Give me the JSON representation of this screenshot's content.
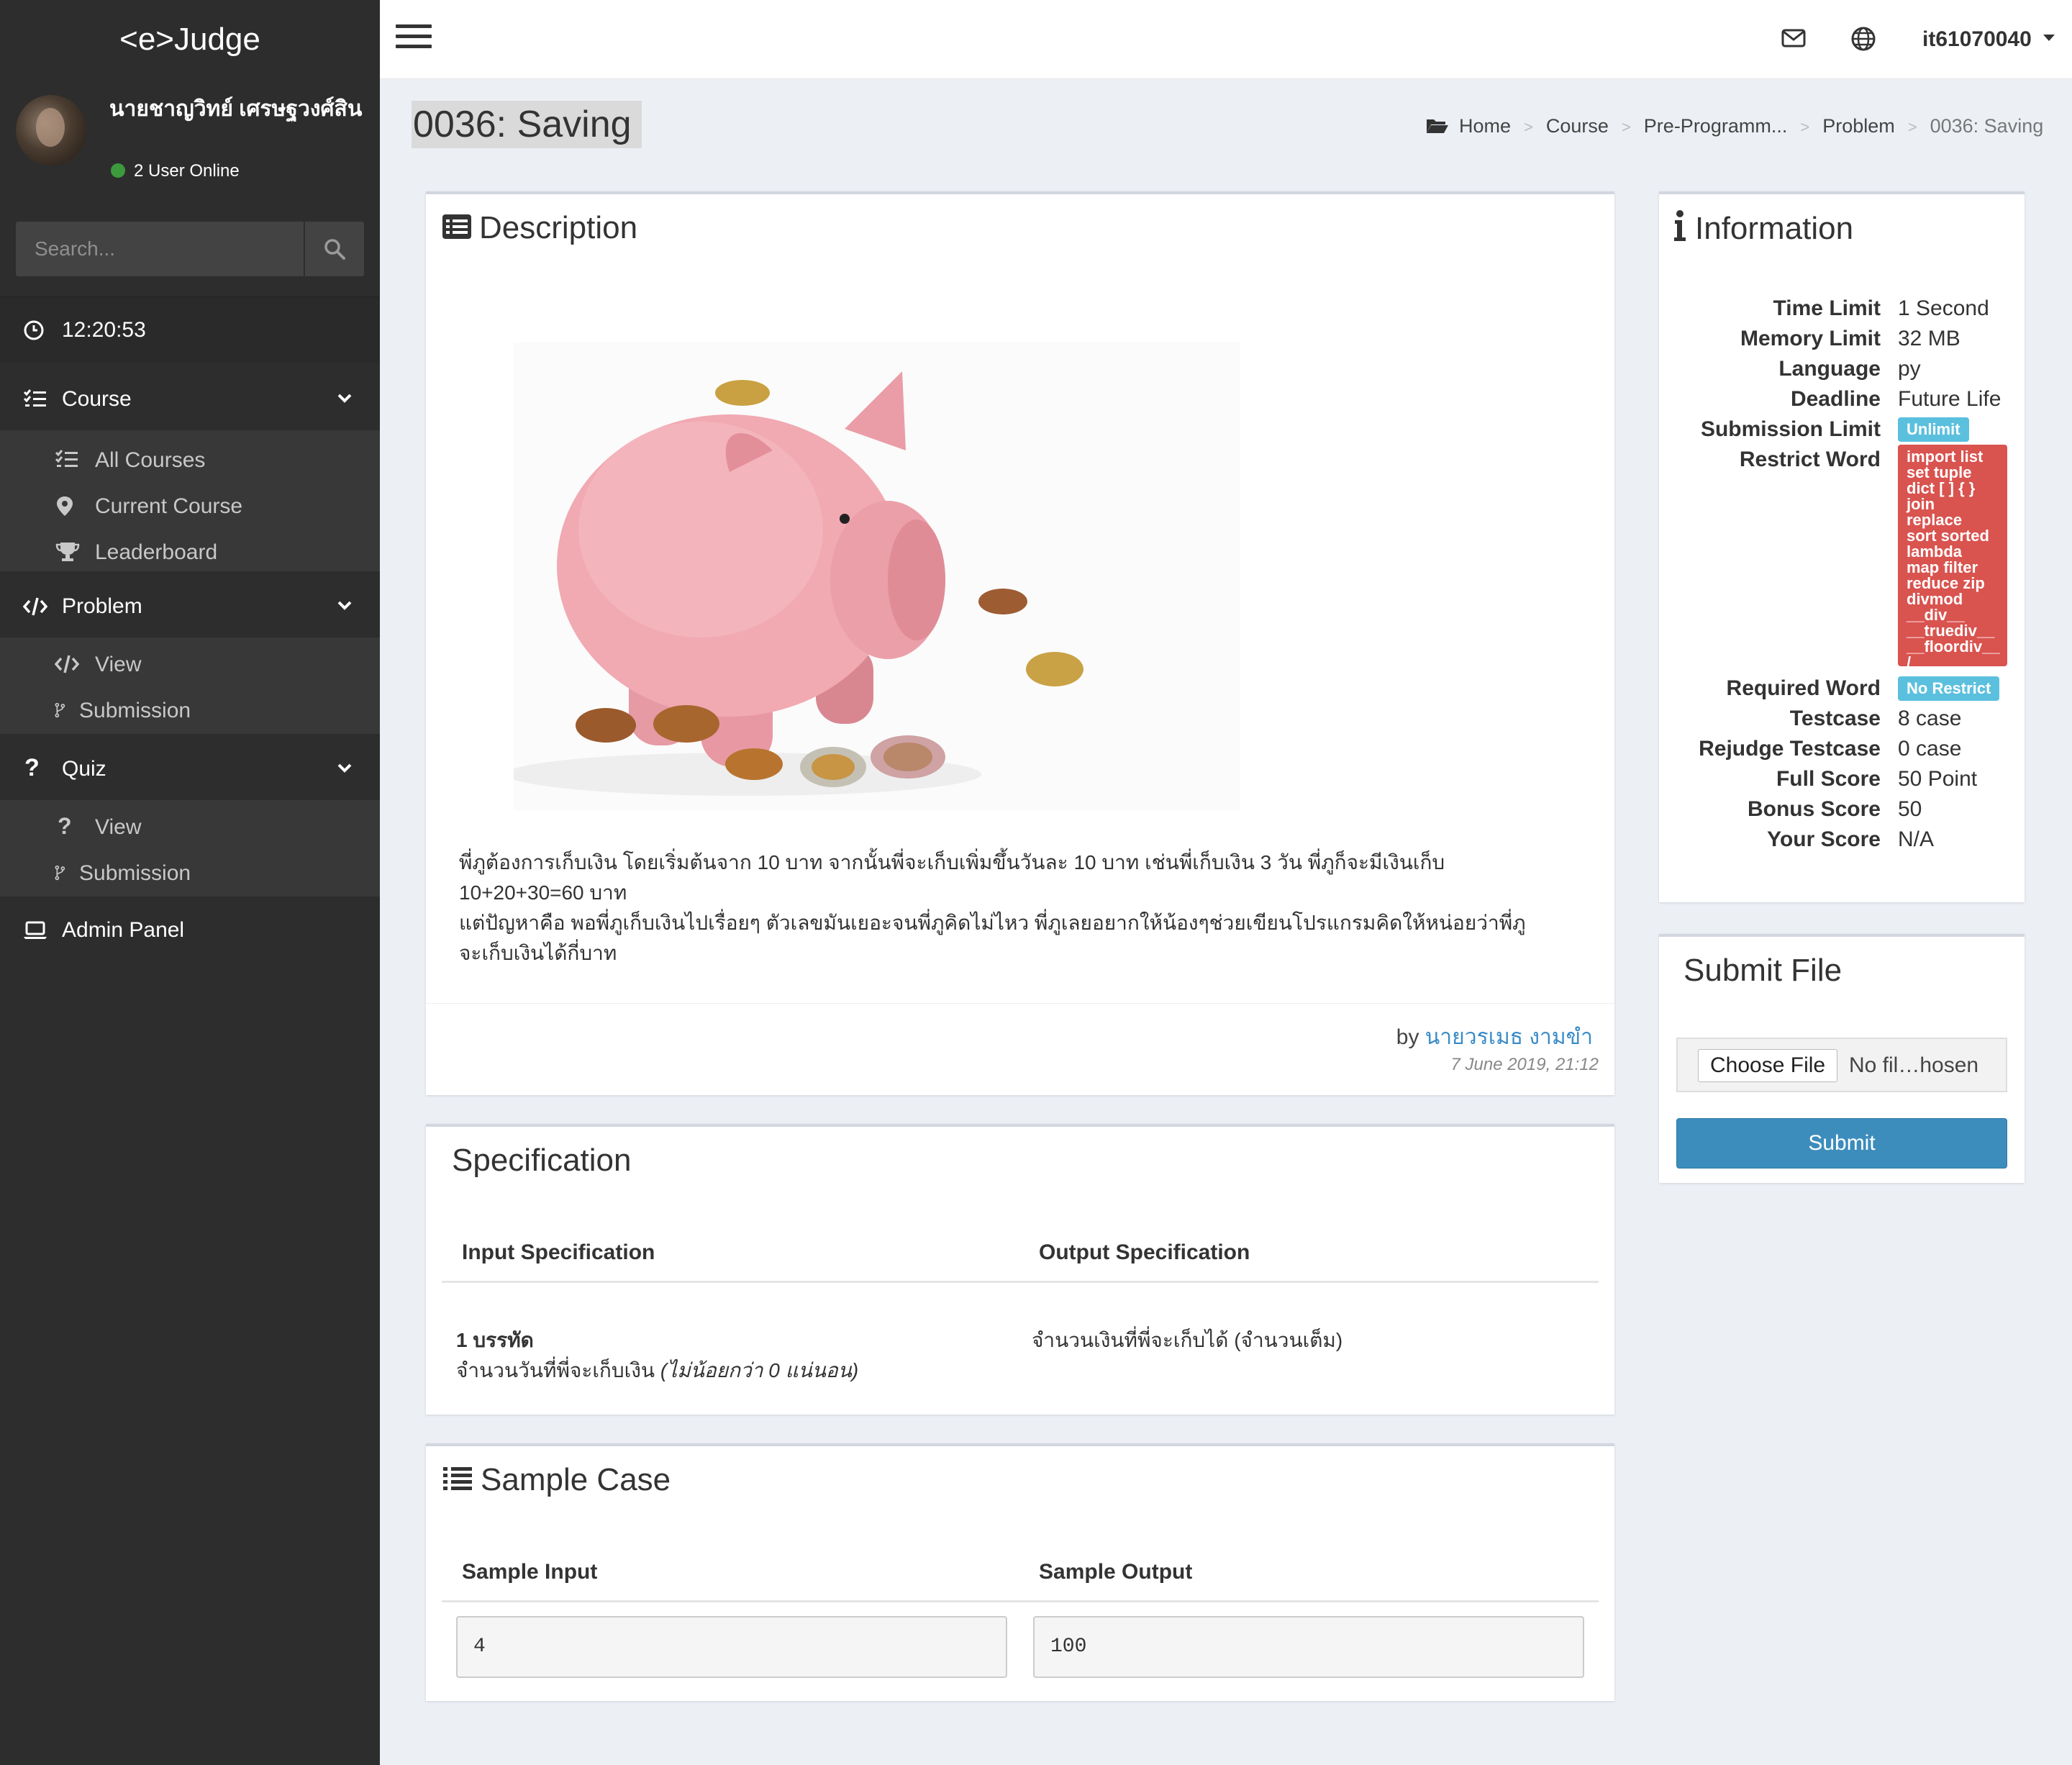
{
  "app": {
    "logo": "<e>Judge"
  },
  "user": {
    "name": "นายชาญวิทย์ เศรษฐวงศ์สิน",
    "online": "2 User Online",
    "username": "it61070040"
  },
  "search": {
    "placeholder": "Search..."
  },
  "clock": {
    "time": "12:20:53"
  },
  "sidebar": {
    "course": {
      "label": "Course",
      "items": [
        "All Courses",
        "Current Course",
        "Leaderboard"
      ]
    },
    "problem": {
      "label": "Problem",
      "items": [
        "View",
        "Submission"
      ]
    },
    "quiz": {
      "label": "Quiz",
      "items": [
        "View",
        "Submission"
      ]
    },
    "admin": {
      "label": "Admin Panel"
    }
  },
  "page": {
    "title": "0036: Saving",
    "breadcrumb": [
      "Home",
      "Course",
      "Pre-Programm...",
      "Problem",
      "0036: Saving"
    ]
  },
  "description": {
    "heading": "Description",
    "line1": "พี่ภูต้องการเก็บเงิน โดยเริ่มต้นจาก 10 บาท จากนั้นพี่จะเก็บเพิ่มขึ้นวันละ 10 บาท เช่นพี่เก็บเงิน 3 วัน พี่ภูก็จะมีเงินเก็บ",
    "line2": "10+20+30=60 บาท",
    "line3": "แต่ปัญหาคือ พอพี่ภูเก็บเงินไปเรื่อยๆ ตัวเลขมันเยอะจนพี่ภูคิดไม่ไหว พี่ภูเลยอยากให้น้องๆช่วยเขียนโปรแกรมคิดให้หน่อยว่าพี่ภู",
    "line4": "จะเก็บเงินได้กี่บาท",
    "by": "by",
    "author": "นายวรเมธ งามขำ",
    "date": "7 June 2019, 21:12"
  },
  "specification": {
    "heading": "Specification",
    "input_header": "Input Specification",
    "output_header": "Output Specification",
    "input_title": "1 บรรทัด",
    "input_text": "จำนวนวันที่พี่จะเก็บเงิน",
    "input_note": "(ไม่น้อยกว่า 0 แน่นอน)",
    "output_text": "จำนวนเงินที่พี่จะเก็บได้ (จำนวนเต็ม)"
  },
  "sample": {
    "heading": "Sample Case",
    "input_header": "Sample Input",
    "output_header": "Sample Output",
    "input_value": "4",
    "output_value": "100"
  },
  "information": {
    "heading": "Information",
    "time_limit": {
      "label": "Time Limit",
      "value": "1 Second"
    },
    "memory_limit": {
      "label": "Memory Limit",
      "value": "32 MB"
    },
    "language": {
      "label": "Language",
      "value": "py"
    },
    "deadline": {
      "label": "Deadline",
      "value": "Future Life"
    },
    "submission_limit": {
      "label": "Submission Limit",
      "value": "Unlimit"
    },
    "restrict_word": {
      "label": "Restrict Word",
      "value": [
        "import list",
        "set tuple",
        "dict [ ] { }",
        "join",
        "replace",
        "sort sorted",
        "lambda",
        "map filter",
        "reduce zip",
        "divmod",
        "__div__",
        "__truediv__",
        "__floordiv__",
        "/"
      ]
    },
    "required_word": {
      "label": "Required Word",
      "value": "No Restrict"
    },
    "testcase": {
      "label": "Testcase",
      "value": "8 case"
    },
    "rejudge_testcase": {
      "label": "Rejudge Testcase",
      "value": "0 case"
    },
    "full_score": {
      "label": "Full Score",
      "value": "50 Point"
    },
    "bonus_score": {
      "label": "Bonus Score",
      "value": "50"
    },
    "your_score": {
      "label": "Your Score",
      "value": "N/A"
    }
  },
  "submit": {
    "heading": "Submit File",
    "choose_label": "Choose File",
    "file_status": "No fil…hosen",
    "submit_label": "Submit"
  },
  "colors": {
    "sidebar_bg": "#2d2d2d",
    "accent": "#3c8dbc",
    "badge_info": "#5bc0de",
    "badge_danger": "#d9534f",
    "online": "#3c9a3c",
    "link": "#3a8bc8"
  },
  "icons": [
    "bars-icon",
    "envelope-icon",
    "globe-icon",
    "caret-down-icon",
    "search-icon",
    "clock-icon",
    "tasks-icon",
    "map-marker-icon",
    "trophy-icon",
    "code-icon",
    "code-fork-icon",
    "question-icon",
    "laptop-icon",
    "folder-open-icon",
    "list-alt-icon",
    "info-icon",
    "list-ol-icon"
  ]
}
